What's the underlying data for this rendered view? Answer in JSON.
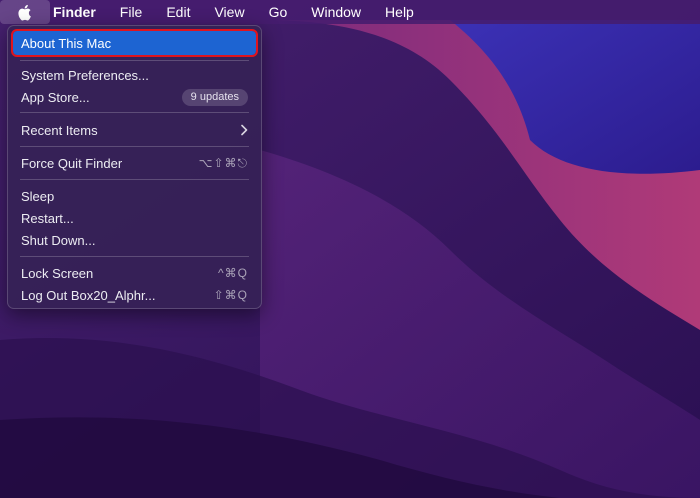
{
  "menubar": {
    "apple_icon": "apple-logo-icon",
    "items": [
      "Finder",
      "File",
      "Edit",
      "View",
      "Go",
      "Window",
      "Help"
    ]
  },
  "apple_menu": {
    "about": "About This Mac",
    "system_prefs": "System Preferences...",
    "app_store": "App Store...",
    "app_store_badge": "9 updates",
    "recent_items": "Recent Items",
    "recent_items_icon": "chevron-right-icon",
    "force_quit": "Force Quit Finder",
    "force_quit_shortcut": "⌥⇧⌘⎋",
    "sleep": "Sleep",
    "restart": "Restart...",
    "shut_down": "Shut Down...",
    "lock_screen": "Lock Screen",
    "lock_screen_shortcut": "^⌘Q",
    "log_out": "Log Out Box20_Alphr...",
    "log_out_shortcut": "⇧⌘Q"
  },
  "colors": {
    "highlight": "#1d64d2",
    "annotation_border": "#e0141e"
  }
}
